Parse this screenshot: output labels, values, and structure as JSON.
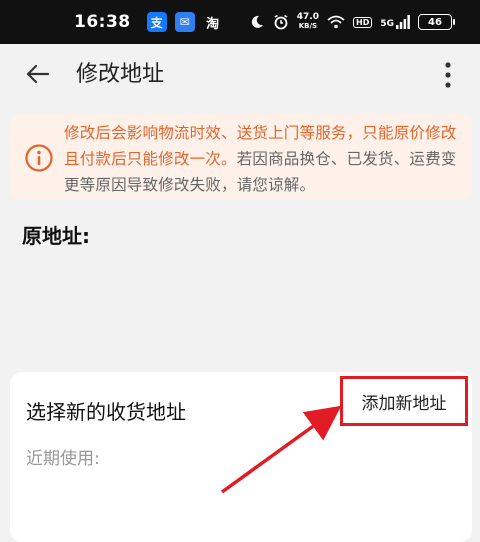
{
  "status_bar": {
    "time": "16:38",
    "apps": [
      {
        "icon": "alipay-icon",
        "glyph": "支"
      },
      {
        "icon": "message-app-icon",
        "glyph": "✉"
      },
      {
        "icon": "taobao-icon",
        "glyph": "淘"
      }
    ],
    "net_speed_value": "47.0",
    "net_speed_unit": "KB/S",
    "hd_label": "HD",
    "signal_label": "5G",
    "battery": "46"
  },
  "header": {
    "title": "修改地址"
  },
  "notice": {
    "highlight": "修改后会影响物流时效、送货上门等服务，只能原价修改且付款后只能修改一次。",
    "rest": "若因商品换仓、已发货、运费变更等原因导致修改失败，请您谅解。",
    "accent_color": "#e3652b"
  },
  "original_address": {
    "label": "原地址:"
  },
  "new_address": {
    "title": "选择新的收货地址",
    "add_button": "添加新地址",
    "recent_label": "近期使用:",
    "annotation_color": "#e21c24"
  }
}
